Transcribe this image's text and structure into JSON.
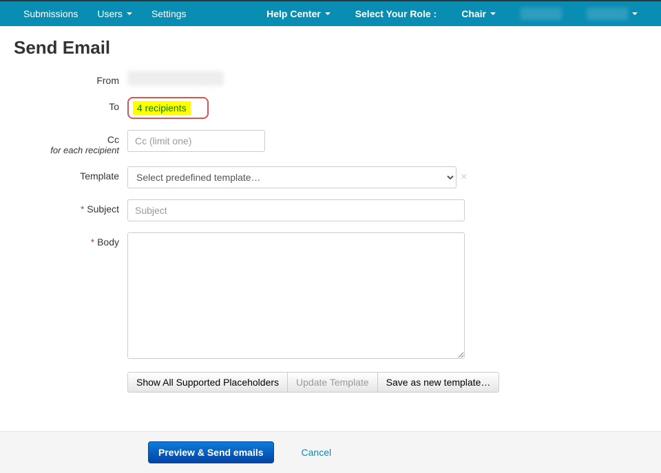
{
  "nav": {
    "submissions": "Submissions",
    "users": "Users",
    "settings": "Settings",
    "help_center": "Help Center",
    "select_role_label": "Select Your Role :",
    "chair": "Chair"
  },
  "page": {
    "title": "Send Email"
  },
  "form": {
    "from_label": "From",
    "to_label": "To",
    "to_value": "4 recipients",
    "cc_label": "Cc",
    "cc_sub": "for each recipient",
    "cc_placeholder": "Cc (limit one)",
    "template_label": "Template",
    "template_placeholder": "Select predefined template…",
    "subject_label": "Subject",
    "subject_placeholder": "Subject",
    "body_label": "Body",
    "required_marker": "* "
  },
  "buttons": {
    "show_placeholders": "Show All Supported Placeholders",
    "update_template": "Update Template",
    "save_template": "Save as new template…",
    "preview_send": "Preview & Send emails",
    "cancel": "Cancel"
  }
}
